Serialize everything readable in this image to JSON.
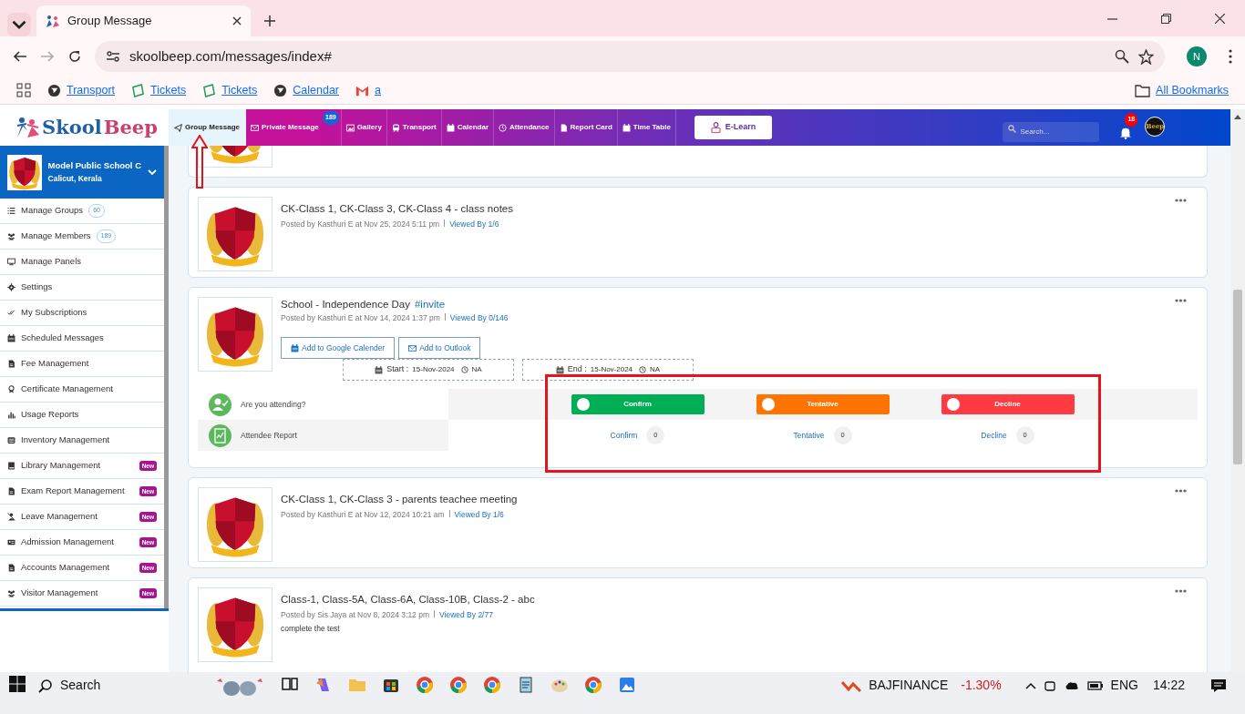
{
  "browser": {
    "tab_title": "Group Message",
    "address": "skoolbeep.com/messages/index#",
    "profile_initial": "N",
    "all_bookmarks": "All Bookmarks",
    "bookmarks": [
      {
        "label": "Transport"
      },
      {
        "label": "Tickets"
      },
      {
        "label": "Tickets"
      },
      {
        "label": "Calendar"
      },
      {
        "label": "a"
      }
    ]
  },
  "nav": {
    "logo_first": "Skool",
    "logo_second": "Beep",
    "elearn": "E-Learn",
    "search_placeholder": "Search...",
    "notifications": "18",
    "avatar_text": "Beep",
    "items": [
      {
        "label": "Group Message",
        "selected": true
      },
      {
        "label": "Private Message",
        "selected": false,
        "badge": "189"
      },
      {
        "label": "Gallery",
        "selected": false
      },
      {
        "label": "Transport",
        "selected": false
      },
      {
        "label": "Calendar",
        "selected": false
      },
      {
        "label": "Attendance",
        "selected": false
      },
      {
        "label": "Report Card",
        "selected": false
      },
      {
        "label": "Time Table",
        "selected": false
      }
    ]
  },
  "sidebar": {
    "school": "Model Public School C",
    "location": "Calicut, Kerala",
    "items": [
      {
        "label": "Manage Groups",
        "count": "60"
      },
      {
        "label": "Manage Members",
        "count": "189"
      },
      {
        "label": "Manage Panels"
      },
      {
        "label": "Settings"
      },
      {
        "label": "My Subscriptions"
      },
      {
        "label": "Scheduled Messages"
      },
      {
        "label": "Fee Management"
      },
      {
        "label": "Certificate Management"
      },
      {
        "label": "Usage Reports"
      },
      {
        "label": "Inventory Management"
      },
      {
        "label": "Library Management",
        "badge": "New"
      },
      {
        "label": "Exam Report Management",
        "badge": "New"
      },
      {
        "label": "Leave Management",
        "badge": "New"
      },
      {
        "label": "Admission Management",
        "badge": "New"
      },
      {
        "label": "Accounts Management",
        "badge": "New"
      },
      {
        "label": "Visitor Management",
        "badge": "New"
      }
    ]
  },
  "posts": [
    {
      "kind": "clipped"
    },
    {
      "kind": "message",
      "title": "CK-Class 1, CK-Class 3, CK-Class 4 - class notes",
      "author": "Posted by Kasthuri E at Nov 25, 2024 5:11 pm",
      "viewed": "Viewed By 1/6"
    },
    {
      "kind": "event",
      "title": "School - Independence Day",
      "hashtag": "#invite",
      "author": "Posted by Kasthuri E at Nov 14, 2024 1:37 pm",
      "viewed": "Viewed By 0/146",
      "calendar_buttons": [
        "Add to Google Calender",
        "Add to Outlook"
      ],
      "start_label": "Start :",
      "start_date": "15-Nov-2024",
      "start_time": "NA",
      "end_label": "End :",
      "end_date": "15-Nov-2024",
      "end_time": "NA",
      "attending_prompt": "Are you attending?",
      "report_label": "Attendee Report",
      "responses": [
        {
          "label": "Confirm",
          "color": "#00ae55",
          "report_label": "Confirm",
          "count": "0"
        },
        {
          "label": "Tentative",
          "color": "#ff7300",
          "report_label": "Tentative",
          "count": "0"
        },
        {
          "label": "Decline",
          "color": "#ff3a40",
          "report_label": "Decline",
          "count": "0"
        }
      ]
    },
    {
      "kind": "message",
      "title": "CK-Class 1, CK-Class 3 - parents teachee meeting",
      "author": "Posted by Kasthuri E at Nov 12, 2024 10:21 am",
      "viewed": "Viewed By 1/6"
    },
    {
      "kind": "message",
      "title": "Class-1, Class-5A, Class-6A, Class-10B, Class-2 - abc",
      "author": "Posted by Sis Jaya at Nov 8, 2024 3:12 pm",
      "viewed": "Viewed By 2/77",
      "body": "complete the test"
    }
  ],
  "taskbar": {
    "search": "Search",
    "ticker": "BAJFINANCE",
    "change": "-1.30%",
    "language": "ENG",
    "time": "14:22"
  }
}
